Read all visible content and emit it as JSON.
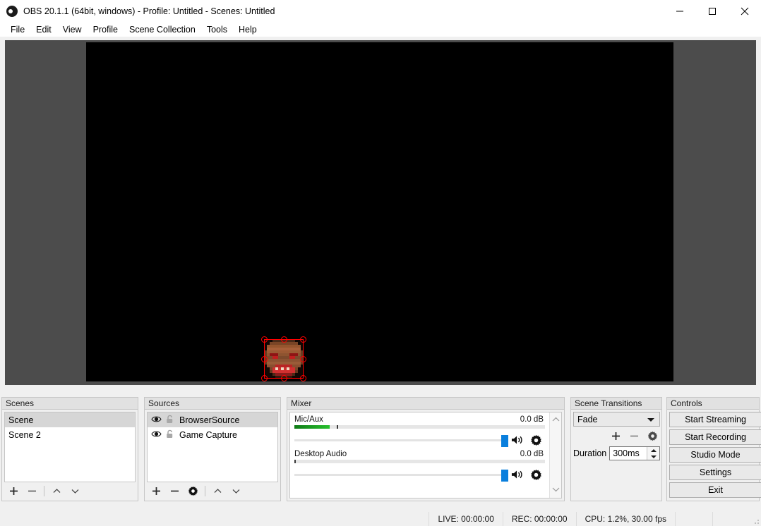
{
  "window": {
    "title": "OBS 20.1.1 (64bit, windows) - Profile: Untitled - Scenes: Untitled",
    "app_icon": "obs-logo-icon",
    "buttons": {
      "minimize": "minimize-icon",
      "maximize": "maximize-icon",
      "close": "close-icon"
    }
  },
  "menubar": {
    "items": [
      {
        "label": "File"
      },
      {
        "label": "Edit"
      },
      {
        "label": "View"
      },
      {
        "label": "Profile"
      },
      {
        "label": "Scene Collection"
      },
      {
        "label": "Tools"
      },
      {
        "label": "Help"
      }
    ]
  },
  "preview": {
    "background_color": "#4c4c4c",
    "canvas_color": "#000000",
    "selection": {
      "color": "#ff0000",
      "handles": 8,
      "source_name": "BrowserSource"
    }
  },
  "scenes": {
    "title": "Scenes",
    "items": [
      {
        "label": "Scene",
        "selected": true
      },
      {
        "label": "Scene 2",
        "selected": false
      }
    ],
    "toolbar": [
      {
        "name": "add-scene-button",
        "icon": "plus-icon"
      },
      {
        "name": "remove-scene-button",
        "icon": "minus-icon"
      },
      {
        "name": "move-scene-up-button",
        "icon": "chevron-up-icon"
      },
      {
        "name": "move-scene-down-button",
        "icon": "chevron-down-icon"
      }
    ]
  },
  "sources": {
    "title": "Sources",
    "items": [
      {
        "label": "BrowserSource",
        "selected": true,
        "visible": true,
        "locked": false
      },
      {
        "label": "Game Capture",
        "selected": false,
        "visible": true,
        "locked": false
      }
    ],
    "toolbar": [
      {
        "name": "add-source-button",
        "icon": "plus-icon"
      },
      {
        "name": "remove-source-button",
        "icon": "minus-icon"
      },
      {
        "name": "source-properties-button",
        "icon": "gear-icon"
      },
      {
        "name": "move-source-up-button",
        "icon": "chevron-up-icon"
      },
      {
        "name": "move-source-down-button",
        "icon": "chevron-down-icon"
      }
    ]
  },
  "mixer": {
    "title": "Mixer",
    "tracks": [
      {
        "name": "Mic/Aux",
        "db": "0.0 dB",
        "meter_percent": 14,
        "peak_percent": 17,
        "volume_percent": 100,
        "mute_icon": "speaker-icon",
        "settings_icon": "gear-icon"
      },
      {
        "name": "Desktop Audio",
        "db": "0.0 dB",
        "meter_percent": 0,
        "peak_percent": 0,
        "volume_percent": 100,
        "mute_icon": "speaker-icon",
        "settings_icon": "gear-icon"
      }
    ],
    "scroll_up_icon": "chevron-up-icon",
    "scroll_down_icon": "chevron-down-icon"
  },
  "scene_transitions": {
    "title": "Scene Transitions",
    "selected_transition": "Fade",
    "options": [
      "Fade"
    ],
    "tools": [
      {
        "name": "add-transition-button",
        "icon": "plus-icon"
      },
      {
        "name": "remove-transition-button",
        "icon": "minus-icon"
      },
      {
        "name": "transition-properties-button",
        "icon": "gear-icon"
      }
    ],
    "duration_label": "Duration",
    "duration_value": "300ms"
  },
  "controls": {
    "title": "Controls",
    "buttons": [
      {
        "label": "Start Streaming"
      },
      {
        "label": "Start Recording"
      },
      {
        "label": "Studio Mode"
      },
      {
        "label": "Settings"
      },
      {
        "label": "Exit"
      }
    ]
  },
  "statusbar": {
    "live": "LIVE: 00:00:00",
    "rec": "REC: 00:00:00",
    "cpu": "CPU: 1.2%, 30.00 fps"
  }
}
